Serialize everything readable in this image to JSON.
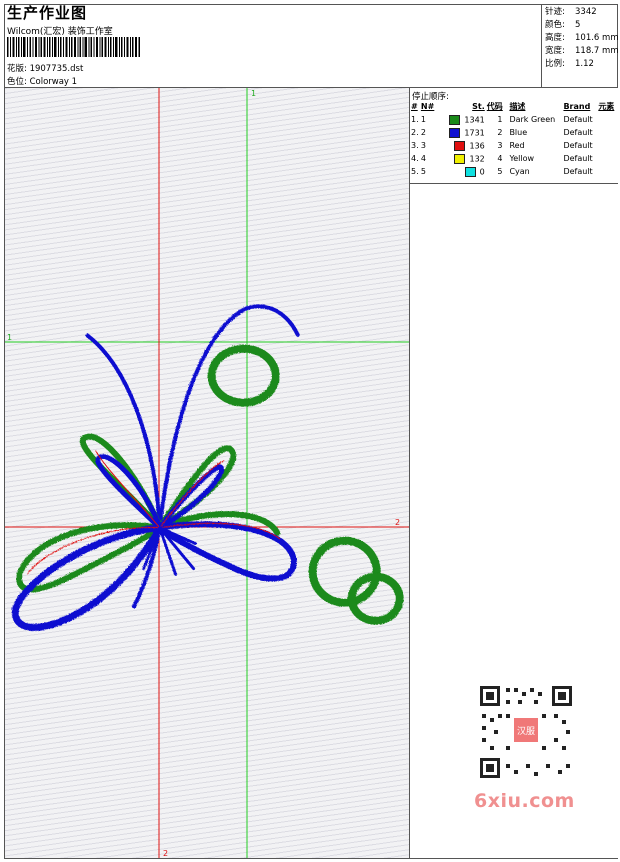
{
  "header": {
    "title": "生产作业图",
    "studio": "Wilcom(汇宏) 装饰工作室",
    "file_label": "花版:",
    "file_name": "1907735.dst",
    "colorway_label": "色位:",
    "colorway": "Colorway 1"
  },
  "stats": [
    {
      "label": "针迹:",
      "value": "3342"
    },
    {
      "label": "颜色:",
      "value": "5"
    },
    {
      "label": "高度:",
      "value": "101.6 mm"
    },
    {
      "label": "宽度:",
      "value": "118.7 mm"
    },
    {
      "label": "比例:",
      "value": "1.12"
    }
  ],
  "sequence": {
    "title": "停止顺序:",
    "columns": [
      "#",
      "N#",
      "St.",
      "代码",
      "描述",
      "Brand",
      "元素"
    ],
    "rows": [
      {
        "num": "1.",
        "n": "1",
        "color": "#1a8a1a",
        "stitches": "1341",
        "code": "1",
        "desc": "Dark Green",
        "brand": "Default"
      },
      {
        "num": "2.",
        "n": "2",
        "color": "#1010d0",
        "stitches": "1731",
        "code": "2",
        "desc": "Blue",
        "brand": "Default"
      },
      {
        "num": "3.",
        "n": "3",
        "color": "#e01010",
        "stitches": "136",
        "code": "3",
        "desc": "Red",
        "brand": "Default"
      },
      {
        "num": "4.",
        "n": "4",
        "color": "#f0f000",
        "stitches": "132",
        "code": "4",
        "desc": "Yellow",
        "brand": "Default"
      },
      {
        "num": "5.",
        "n": "5",
        "color": "#10e0e0",
        "stitches": "0",
        "code": "5",
        "desc": "Cyan",
        "brand": "Default"
      }
    ]
  },
  "guides": {
    "v1": "1",
    "h1": "1",
    "h2": "2",
    "v2": "2"
  },
  "qr": {
    "stamp_text": "汉服"
  },
  "watermark": "6xiu.com",
  "colors": {
    "green": "#1a8a1a",
    "blue": "#1010d0",
    "red": "#e01010",
    "guide_green": "#22cc22",
    "guide_red": "#dd1111"
  }
}
